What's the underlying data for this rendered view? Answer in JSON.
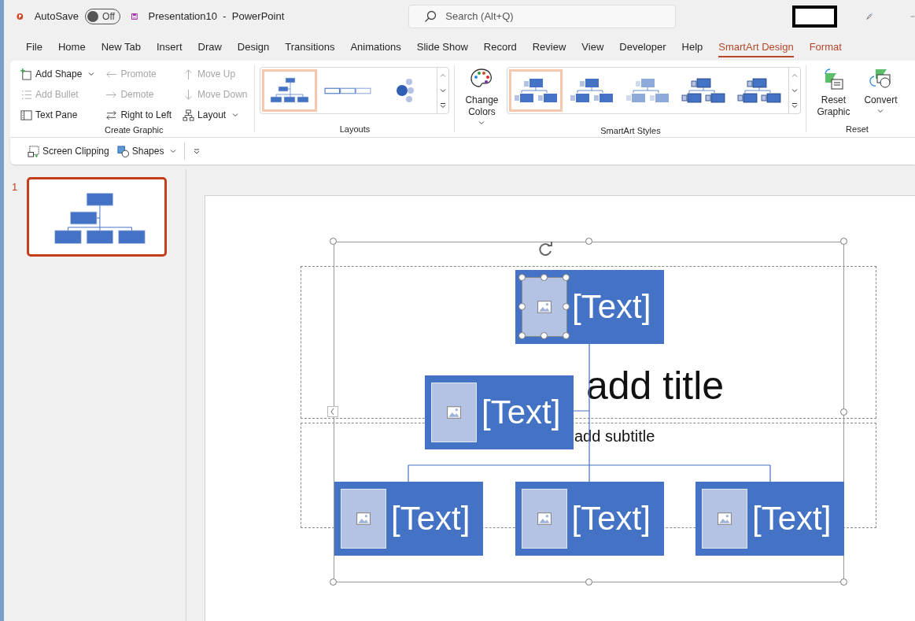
{
  "titlebar": {
    "autosave_label": "AutoSave",
    "autosave": {
      "on": false,
      "label": "Off"
    },
    "document_title": "Presentation10  -  PowerPoint",
    "search": {
      "placeholder": "Search (Alt+Q)"
    }
  },
  "menu_tabs": [
    {
      "label": "File",
      "selected": false,
      "contextual": false
    },
    {
      "label": "Home",
      "selected": false,
      "contextual": false
    },
    {
      "label": "New Tab",
      "selected": false,
      "contextual": false
    },
    {
      "label": "Insert",
      "selected": false,
      "contextual": false
    },
    {
      "label": "Draw",
      "selected": false,
      "contextual": false
    },
    {
      "label": "Design",
      "selected": false,
      "contextual": false
    },
    {
      "label": "Transitions",
      "selected": false,
      "contextual": false
    },
    {
      "label": "Animations",
      "selected": false,
      "contextual": false
    },
    {
      "label": "Slide Show",
      "selected": false,
      "contextual": false
    },
    {
      "label": "Record",
      "selected": false,
      "contextual": false
    },
    {
      "label": "Review",
      "selected": false,
      "contextual": false
    },
    {
      "label": "View",
      "selected": false,
      "contextual": false
    },
    {
      "label": "Developer",
      "selected": false,
      "contextual": false
    },
    {
      "label": "Help",
      "selected": false,
      "contextual": false
    },
    {
      "label": "SmartArt Design",
      "selected": true,
      "contextual": true
    },
    {
      "label": "Format",
      "selected": false,
      "contextual": true
    }
  ],
  "ribbon": {
    "create_graphic": {
      "label": "Create Graphic",
      "columns": [
        [
          {
            "kind": "add-shape",
            "label": "Add Shape",
            "disabled": false,
            "dropdown": true
          },
          {
            "kind": "add-bullet",
            "label": "Add Bullet",
            "disabled": true,
            "dropdown": false
          },
          {
            "kind": "text-pane",
            "label": "Text Pane",
            "disabled": false,
            "dropdown": false
          }
        ],
        [
          {
            "kind": "promote",
            "label": "Promote",
            "disabled": true,
            "dropdown": false
          },
          {
            "kind": "demote",
            "label": "Demote",
            "disabled": true,
            "dropdown": false
          },
          {
            "kind": "right-to-left",
            "label": "Right to Left",
            "disabled": false,
            "dropdown": false
          }
        ],
        [
          {
            "kind": "move-up",
            "label": "Move Up",
            "disabled": true,
            "dropdown": false
          },
          {
            "kind": "move-down",
            "label": "Move Down",
            "disabled": true,
            "dropdown": false
          },
          {
            "kind": "layout",
            "label": "Layout",
            "disabled": false,
            "dropdown": true
          }
        ]
      ]
    },
    "layouts": {
      "label": "Layouts",
      "items": [
        {
          "kind": "org",
          "selected": true
        },
        {
          "kind": "horizontal",
          "selected": false
        },
        {
          "kind": "circle",
          "selected": false
        }
      ]
    },
    "smartart_styles": {
      "label": "SmartArt Styles",
      "change_colors": "Change Colors",
      "items": [
        {
          "kind": "flat",
          "selected": true
        },
        {
          "kind": "flat",
          "selected": false
        },
        {
          "kind": "light",
          "selected": false
        },
        {
          "kind": "outlined",
          "selected": false
        },
        {
          "kind": "shadow",
          "selected": false
        }
      ]
    },
    "reset": {
      "label": "Reset",
      "buttons": [
        {
          "kind": "reset",
          "label": "Reset Graphic"
        },
        {
          "kind": "convert",
          "label": "Convert"
        }
      ]
    }
  },
  "quick_access": [
    {
      "kind": "screen-clipping",
      "label": "Screen Clipping",
      "dropdown": false
    },
    {
      "kind": "shapes",
      "label": "Shapes",
      "dropdown": true
    }
  ],
  "slides": [
    {
      "number": "1",
      "selected": true
    }
  ],
  "slide": {
    "title": "add title",
    "subtitle": "add subtitle",
    "nodes": [
      {
        "kind": "top",
        "text": "[Text]",
        "selected": true
      },
      {
        "kind": "assistant",
        "text": "[Text]",
        "selected": false
      },
      {
        "kind": "child",
        "text": "[Text]",
        "selected": false
      },
      {
        "kind": "child",
        "text": "[Text]",
        "selected": false
      },
      {
        "kind": "child",
        "text": "[Text]",
        "selected": false
      }
    ]
  }
}
